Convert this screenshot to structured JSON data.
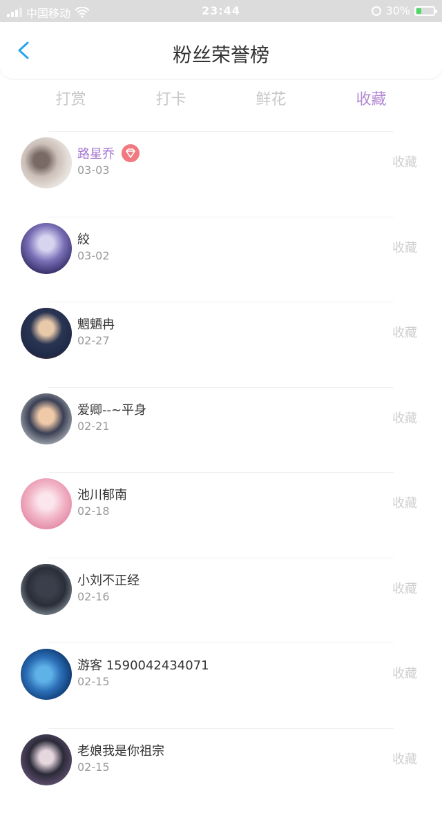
{
  "status_bar": {
    "carrier": "中国移动",
    "time": "23:44",
    "battery_percent": "30%"
  },
  "header": {
    "title": "粉丝荣誉榜"
  },
  "tabs": [
    {
      "label": "打赏",
      "active": false
    },
    {
      "label": "打卡",
      "active": false
    },
    {
      "label": "鲜花",
      "active": false
    },
    {
      "label": "收藏",
      "active": true
    }
  ],
  "list": {
    "items": [
      {
        "name": "路星乔",
        "date": "03-03",
        "action": "收藏",
        "vip": true,
        "badge_icon": "diamond-icon"
      },
      {
        "name": "絞",
        "date": "03-02",
        "action": "收藏"
      },
      {
        "name": "魍魉冉",
        "date": "02-27",
        "action": "收藏"
      },
      {
        "name": "爱卿--~平身",
        "date": "02-21",
        "action": "收藏"
      },
      {
        "name": "池川郁南",
        "date": "02-18",
        "action": "收藏"
      },
      {
        "name": "小刘不正经",
        "date": "02-16",
        "action": "收藏"
      },
      {
        "name": "游客 1590042434071",
        "date": "02-15",
        "action": "收藏"
      },
      {
        "name": "老娘我是你祖宗",
        "date": "02-15",
        "action": "收藏"
      }
    ]
  },
  "colors": {
    "accent_purple": "#b48ad6",
    "back_blue": "#2aa3f2",
    "badge_red": "#f07a80"
  }
}
